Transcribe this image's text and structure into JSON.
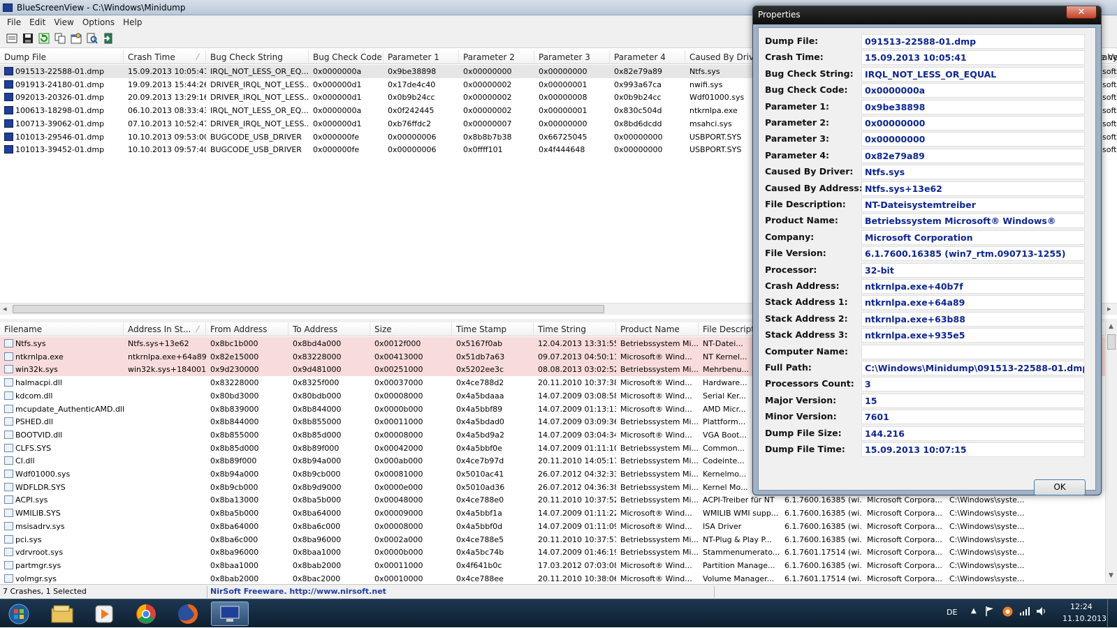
{
  "window": {
    "title": "BlueScreenView  -  C:\\Windows\\Minidump"
  },
  "menu": [
    "File",
    "Edit",
    "View",
    "Options",
    "Help"
  ],
  "toolbar_icons": [
    "save-list-icon",
    "save-icon",
    "refresh-icon",
    "copy-icon",
    "properties-icon",
    "find-icon",
    "exit-icon"
  ],
  "top_table": {
    "columns": [
      "Dump File",
      "Crash Time",
      "Bug Check String",
      "Bug Check Code",
      "Parameter 1",
      "Parameter 2",
      "Parameter 3",
      "Parameter 4",
      "Caused By Driver",
      "Caused By Address",
      "File Description",
      "Product Name",
      "Company",
      "File Version",
      "Processor",
      "Crash Address",
      "Stack Address 1"
    ],
    "sort_col": 1,
    "rows": [
      [
        "091513-22588-01.dmp",
        "15.09.2013 10:05:41",
        "IRQL_NOT_LESS_OR_EQ...",
        "0x0000000a",
        "0x9be38898",
        "0x00000000",
        "0x00000000",
        "0x82e79a89",
        "Ntfs.sys",
        "Ntfs.sys+13e62",
        "",
        "",
        "soft"
      ],
      [
        "091913-24180-01.dmp",
        "19.09.2013 15:44:26",
        "DRIVER_IRQL_NOT_LESS...",
        "0x000000d1",
        "0x17de4c40",
        "0x00000002",
        "0x00000001",
        "0x993a67ca",
        "nwifi.sys",
        "",
        "",
        "",
        "soft"
      ],
      [
        "092013-20326-01.dmp",
        "20.09.2013 13:29:16",
        "DRIVER_IRQL_NOT_LESS...",
        "0x000000d1",
        "0x0b9b24cc",
        "0x00000002",
        "0x00000008",
        "0x0b9b24cc",
        "Wdf01000.sys",
        "",
        "",
        "",
        "soft"
      ],
      [
        "100613-18298-01.dmp",
        "06.10.2013 08:33:43",
        "IRQL_NOT_LESS_OR_EQ...",
        "0x0000000a",
        "0x0f242445",
        "0x00000002",
        "0x00000001",
        "0x830c504d",
        "ntkrnlpa.exe",
        "",
        "",
        "",
        "soft"
      ],
      [
        "100713-39062-01.dmp",
        "07.10.2013 10:52:47",
        "DRIVER_IRQL_NOT_LESS...",
        "0x000000d1",
        "0xb76ffdc2",
        "0x00000007",
        "0x00000000",
        "0x8bd6dcdd",
        "msahci.sys",
        "",
        "",
        "",
        "soft"
      ],
      [
        "101013-29546-01.dmp",
        "10.10.2013 09:53:00",
        "BUGCODE_USB_DRIVER",
        "0x000000fe",
        "0x00000006",
        "0x8b8b7b38",
        "0x66725045",
        "0x00000000",
        "USBPORT.SYS",
        "",
        "",
        "",
        "soft"
      ],
      [
        "101013-39452-01.dmp",
        "10.10.2013 09:57:40",
        "BUGCODE_USB_DRIVER",
        "0x000000fe",
        "0x00000006",
        "0x0ffff101",
        "0x4f444648",
        "0x00000000",
        "USBPORT.SYS",
        "",
        "",
        "",
        "soft"
      ]
    ]
  },
  "top_hdr_right": "any",
  "bottom_table": {
    "columns": [
      "Filename",
      "Address In St...",
      "From Address",
      "To Address",
      "Size",
      "Time Stamp",
      "Time String",
      "Product Name",
      "File Description",
      "File Version",
      "Company",
      "Full Path"
    ],
    "rows": [
      [
        "Ntfs.sys",
        "Ntfs.sys+13e62",
        "0x8bc1b000",
        "0x8bd4a000",
        "0x0012f000",
        "0x5167f0ab",
        "12.04.2013 13:31:55",
        "Betriebssystem Mi...",
        "NT-Datei...",
        "",
        "",
        ""
      ],
      [
        "ntkrnlpa.exe",
        "ntkrnlpa.exe+64a89",
        "0x82e15000",
        "0x83228000",
        "0x00413000",
        "0x51db7a63",
        "09.07.2013 04:50:11",
        "Microsoft® Wind...",
        "NT Kernel...",
        "",
        "",
        ""
      ],
      [
        "win32k.sys",
        "win32k.sys+184001",
        "0x9d230000",
        "0x9d481000",
        "0x00251000",
        "0x5202ee3c",
        "08.08.2013 03:02:52",
        "Betriebssystem Mi...",
        "Mehrbenu...",
        "",
        "",
        ""
      ],
      [
        "halmacpi.dll",
        "",
        "0x83228000",
        "0x8325f000",
        "0x00037000",
        "0x4ce788d2",
        "20.11.2010 10:37:38",
        "Microsoft® Wind...",
        "Hardware...",
        "",
        "",
        ""
      ],
      [
        "kdcom.dll",
        "",
        "0x80bd3000",
        "0x80bdb000",
        "0x00008000",
        "0x4a5bdaaa",
        "14.07.2009 03:08:58",
        "Microsoft® Wind...",
        "Serial Ker...",
        "",
        "",
        ""
      ],
      [
        "mcupdate_AuthenticAMD.dll",
        "",
        "0x8b839000",
        "0x8b844000",
        "0x0000b000",
        "0x4a5bbf89",
        "14.07.2009 01:13:13",
        "Microsoft® Wind...",
        "AMD Micr...",
        "",
        "",
        ""
      ],
      [
        "PSHED.dll",
        "",
        "0x8b844000",
        "0x8b855000",
        "0x00011000",
        "0x4a5bdad0",
        "14.07.2009 03:09:36",
        "Betriebssystem Mi...",
        "Plattform...",
        "",
        "",
        ""
      ],
      [
        "BOOTVID.dll",
        "",
        "0x8b855000",
        "0x8b85d000",
        "0x00008000",
        "0x4a5bd9a2",
        "14.07.2009 03:04:34",
        "Microsoft® Wind...",
        "VGA Boot...",
        "",
        "",
        ""
      ],
      [
        "CLFS.SYS",
        "",
        "0x8b85d000",
        "0x8b89f000",
        "0x00042000",
        "0x4a5bbf0e",
        "14.07.2009 01:11:10",
        "Betriebssystem Mi...",
        "Common...",
        "",
        "",
        ""
      ],
      [
        "CI.dll",
        "",
        "0x8b89f000",
        "0x8b94a000",
        "0x000ab000",
        "0x4ce7b97d",
        "20.11.2010 14:05:17",
        "Betriebssystem Mi...",
        "Codeinte...",
        "",
        "",
        ""
      ],
      [
        "Wdf01000.sys",
        "",
        "0x8b94a000",
        "0x8b9cb000",
        "0x00081000",
        "0x5010ac41",
        "26.07.2012 04:32:33",
        "Betriebssystem Mi...",
        "Kernelmo...",
        "",
        "",
        ""
      ],
      [
        "WDFLDR.SYS",
        "",
        "0x8b9cb000",
        "0x8b9d9000",
        "0x0000e000",
        "0x5010ad36",
        "26.07.2012 04:36:38",
        "Betriebssystem Mi...",
        "Kernel Mo...",
        "",
        "",
        ""
      ],
      [
        "ACPI.sys",
        "",
        "0x8ba13000",
        "0x8ba5b000",
        "0x00048000",
        "0x4ce788e0",
        "20.11.2010 10:37:52",
        "Betriebssystem Mi...",
        "ACPI-Treiber für NT",
        "6.1.7600.16385 (wi...",
        "Microsoft Corpora...",
        "C:\\Windows\\syste..."
      ],
      [
        "WMILIB.SYS",
        "",
        "0x8ba5b000",
        "0x8ba64000",
        "0x00009000",
        "0x4a5bbf1a",
        "14.07.2009 01:11:22",
        "Microsoft® Wind...",
        "WMILIB WMI supp...",
        "6.1.7600.16385 (wi...",
        "Microsoft Corpora...",
        "C:\\Windows\\syste..."
      ],
      [
        "msisadrv.sys",
        "",
        "0x8ba64000",
        "0x8ba6c000",
        "0x00008000",
        "0x4a5bbf0d",
        "14.07.2009 01:11:09",
        "Microsoft® Wind...",
        "ISA Driver",
        "6.1.7600.16385 (wi...",
        "Microsoft Corpora...",
        "C:\\Windows\\syste..."
      ],
      [
        "pci.sys",
        "",
        "0x8ba6c000",
        "0x8ba96000",
        "0x0002a000",
        "0x4ce788e5",
        "20.11.2010 10:37:57",
        "Betriebssystem Mi...",
        "NT-Plug & Play P...",
        "6.1.7600.16385 (wi...",
        "Microsoft Corpora...",
        "C:\\Windows\\syste..."
      ],
      [
        "vdrvroot.sys",
        "",
        "0x8ba96000",
        "0x8baa1000",
        "0x0000b000",
        "0x4a5bc74b",
        "14.07.2009 01:46:19",
        "Betriebssystem Mi...",
        "Stammenumerato...",
        "6.1.7601.17514 (wi...",
        "Microsoft Corpora...",
        "C:\\Windows\\syste..."
      ],
      [
        "partmgr.sys",
        "",
        "0x8baa1000",
        "0x8bab2000",
        "0x00011000",
        "0x4f641b0c",
        "17.03.2012 07:03:08",
        "Microsoft® Wind...",
        "Partition Manage...",
        "6.1.7600.16385 (wi...",
        "Microsoft Corpora...",
        "C:\\Windows\\syste..."
      ],
      [
        "volmgr.sys",
        "",
        "0x8bab2000",
        "0x8bac2000",
        "0x00010000",
        "0x4ce788ee",
        "20.11.2010 10:38:06",
        "Microsoft® Wind...",
        "Volume Manager...",
        "6.1.7601.17514 (wi...",
        "Microsoft Corpora...",
        "C:\\Windows\\syste..."
      ]
    ]
  },
  "properties": {
    "title": "Properties",
    "close": "✕",
    "ok": "OK",
    "fields": [
      {
        "label": "Dump File:",
        "value": "091513-22588-01.dmp"
      },
      {
        "label": "Crash Time:",
        "value": "15.09.2013 10:05:41"
      },
      {
        "label": "Bug Check String:",
        "value": "IRQL_NOT_LESS_OR_EQUAL"
      },
      {
        "label": "Bug Check Code:",
        "value": "0x0000000a"
      },
      {
        "label": "Parameter 1:",
        "value": "0x9be38898"
      },
      {
        "label": "Parameter 2:",
        "value": "0x00000000"
      },
      {
        "label": "Parameter 3:",
        "value": "0x00000000"
      },
      {
        "label": "Parameter 4:",
        "value": "0x82e79a89"
      },
      {
        "label": "Caused By Driver:",
        "value": "Ntfs.sys"
      },
      {
        "label": "Caused By Address:",
        "value": "Ntfs.sys+13e62"
      },
      {
        "label": "File Description:",
        "value": "NT-Dateisystemtreiber"
      },
      {
        "label": "Product Name:",
        "value": "Betriebssystem Microsoft® Windows®"
      },
      {
        "label": "Company:",
        "value": "Microsoft Corporation"
      },
      {
        "label": "File Version:",
        "value": "6.1.7600.16385 (win7_rtm.090713-1255)"
      },
      {
        "label": "Processor:",
        "value": "32-bit"
      },
      {
        "label": "Crash Address:",
        "value": "ntkrnlpa.exe+40b7f"
      },
      {
        "label": "Stack Address 1:",
        "value": "ntkrnlpa.exe+64a89"
      },
      {
        "label": "Stack Address 2:",
        "value": "ntkrnlpa.exe+63b88"
      },
      {
        "label": "Stack Address 3:",
        "value": "ntkrnlpa.exe+935e5"
      },
      {
        "label": "Computer Name:",
        "value": ""
      },
      {
        "label": "Full Path:",
        "value": "C:\\Windows\\Minidump\\091513-22588-01.dmp"
      },
      {
        "label": "Processors Count:",
        "value": "3"
      },
      {
        "label": "Major Version:",
        "value": "15"
      },
      {
        "label": "Minor Version:",
        "value": "7601"
      },
      {
        "label": "Dump File Size:",
        "value": "144.216"
      },
      {
        "label": "Dump File Time:",
        "value": "15.09.2013 10:07:15"
      }
    ]
  },
  "status": {
    "count": "7 Crashes, 1 Selected",
    "credit": "NirSoft Freeware.  http://www.nirsoft.net"
  },
  "taskbar": {
    "lang": "DE",
    "time": "12:24",
    "date": "11.10.2013",
    "apps": [
      "start-button",
      "explorer-icon",
      "media-player-icon",
      "chrome-icon",
      "firefox-icon",
      "bluescreenview-icon"
    ],
    "tray_icons": [
      "show-hidden-icon",
      "flag-icon",
      "avast-icon",
      "network-icon",
      "volume-icon"
    ]
  },
  "colors": {
    "selected_row": "#e6e6e6",
    "crash_driver_row": "#f8dcdc",
    "value_text": "#0d2690",
    "link": "#1f3ea6"
  }
}
